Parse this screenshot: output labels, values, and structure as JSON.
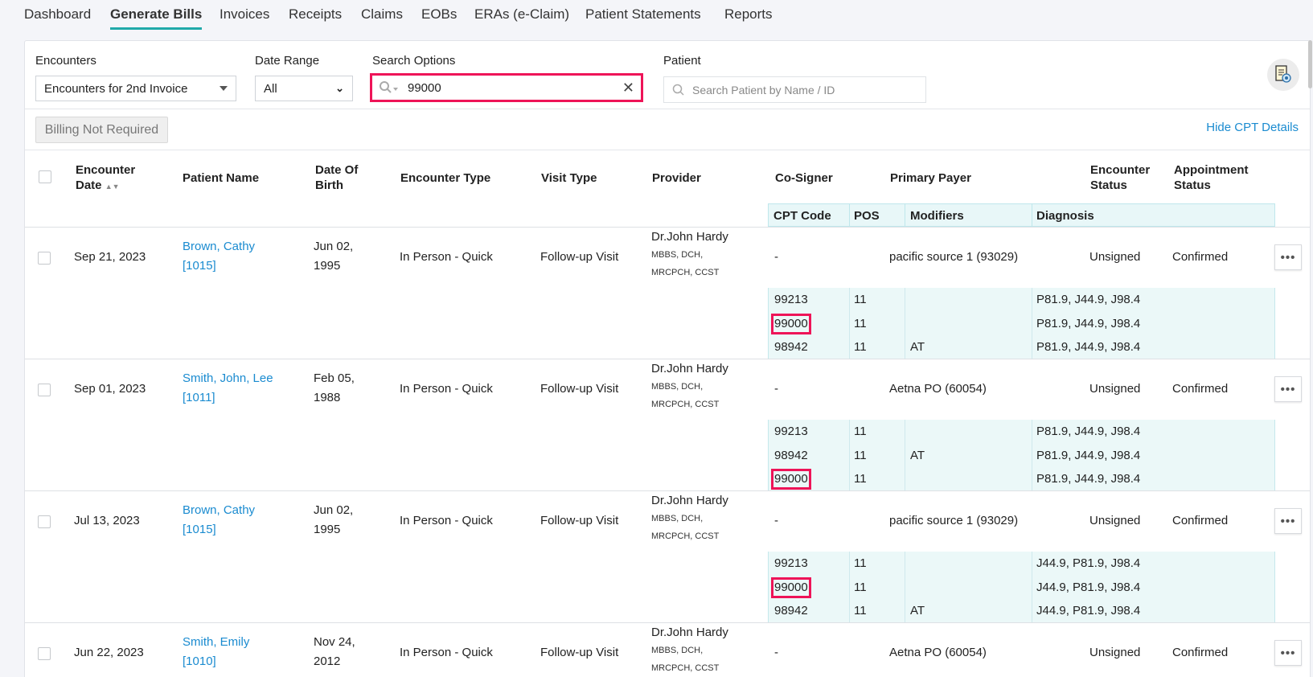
{
  "nav": {
    "items": [
      {
        "label": "Dashboard",
        "active": false
      },
      {
        "label": "Generate Bills",
        "active": true
      },
      {
        "label": "Invoices",
        "active": false
      },
      {
        "label": "Receipts",
        "active": false
      },
      {
        "label": "Claims",
        "active": false
      },
      {
        "label": "EOBs",
        "active": false
      },
      {
        "label": "ERAs (e-Claim)",
        "active": false
      },
      {
        "label": "Patient Statements",
        "active": false
      },
      {
        "label": "Reports",
        "active": false
      }
    ]
  },
  "filters": {
    "encounters_label": "Encounters",
    "encounters_value": "Encounters for 2nd Invoice",
    "date_range_label": "Date Range",
    "date_range_value": "All",
    "search_options_label": "Search Options",
    "search_value": "99000",
    "patient_label": "Patient",
    "patient_placeholder": "Search Patient by Name / ID",
    "view_icon": "document-eye-icon"
  },
  "actions": {
    "billing_not_required": "Billing Not Required",
    "hide_cpt": "Hide CPT Details"
  },
  "table": {
    "headers": {
      "encounter_date": "Encounter Date",
      "patient_name": "Patient Name",
      "dob": "Date Of Birth",
      "encounter_type": "Encounter Type",
      "visit_type": "Visit Type",
      "provider": "Provider",
      "cosigner": "Co-Signer",
      "primary_payer": "Primary Payer",
      "encounter_status": "Encounter Status",
      "appointment_status": "Appointment Status",
      "cpt_code": "CPT Code",
      "pos": "POS",
      "modifiers": "Modifiers",
      "diagnosis": "Diagnosis"
    },
    "rows": [
      {
        "date": "Sep 21, 2023",
        "patient": "Brown, Cathy",
        "patient_id": "[1015]",
        "dob_1": "Jun 02,",
        "dob_2": "1995",
        "encounter_type": "In Person - Quick",
        "visit_type": "Follow-up Visit",
        "provider": "Dr.John Hardy",
        "provider_cred_1": "MBBS, DCH,",
        "provider_cred_2": "MRCPCH, CCST",
        "cosigner": "-",
        "payer": "pacific source 1 (93029)",
        "encounter_status": "Unsigned",
        "appointment_status": "Confirmed",
        "cpt": [
          {
            "code": "99213",
            "pos": "11",
            "modifiers": "",
            "diagnosis": "P81.9, J44.9, J98.4",
            "match": false
          },
          {
            "code": "99000",
            "pos": "11",
            "modifiers": "",
            "diagnosis": "P81.9, J44.9, J98.4",
            "match": true
          },
          {
            "code": "98942",
            "pos": "11",
            "modifiers": "AT",
            "diagnosis": "P81.9, J44.9, J98.4",
            "match": false
          }
        ]
      },
      {
        "date": "Sep 01, 2023",
        "patient": "Smith, John, Lee",
        "patient_id": "[1011]",
        "dob_1": "Feb 05,",
        "dob_2": "1988",
        "encounter_type": "In Person - Quick",
        "visit_type": "Follow-up Visit",
        "provider": "Dr.John Hardy",
        "provider_cred_1": "MBBS, DCH,",
        "provider_cred_2": "MRCPCH, CCST",
        "cosigner": "-",
        "payer": "Aetna PO (60054)",
        "encounter_status": "Unsigned",
        "appointment_status": "Confirmed",
        "cpt": [
          {
            "code": "99213",
            "pos": "11",
            "modifiers": "",
            "diagnosis": "P81.9, J44.9, J98.4",
            "match": false
          },
          {
            "code": "98942",
            "pos": "11",
            "modifiers": "AT",
            "diagnosis": "P81.9, J44.9, J98.4",
            "match": false
          },
          {
            "code": "99000",
            "pos": "11",
            "modifiers": "",
            "diagnosis": "P81.9, J44.9, J98.4",
            "match": true
          }
        ]
      },
      {
        "date": "Jul 13, 2023",
        "patient": "Brown, Cathy",
        "patient_id": "[1015]",
        "dob_1": "Jun 02,",
        "dob_2": "1995",
        "encounter_type": "In Person - Quick",
        "visit_type": "Follow-up Visit",
        "provider": "Dr.John Hardy",
        "provider_cred_1": "MBBS, DCH,",
        "provider_cred_2": "MRCPCH, CCST",
        "cosigner": "-",
        "payer": "pacific source 1 (93029)",
        "encounter_status": "Unsigned",
        "appointment_status": "Confirmed",
        "cpt": [
          {
            "code": "99213",
            "pos": "11",
            "modifiers": "",
            "diagnosis": "J44.9, P81.9, J98.4",
            "match": false
          },
          {
            "code": "99000",
            "pos": "11",
            "modifiers": "",
            "diagnosis": "J44.9, P81.9, J98.4",
            "match": true
          },
          {
            "code": "98942",
            "pos": "11",
            "modifiers": "AT",
            "diagnosis": "J44.9, P81.9, J98.4",
            "match": false
          }
        ]
      },
      {
        "date": "Jun 22, 2023",
        "patient": "Smith, Emily",
        "patient_id": "[1010]",
        "dob_1": "Nov 24,",
        "dob_2": "2012",
        "encounter_type": "In Person - Quick",
        "visit_type": "Follow-up Visit",
        "provider": "Dr.John Hardy",
        "provider_cred_1": "MBBS, DCH,",
        "provider_cred_2": "MRCPCH, CCST",
        "cosigner": "-",
        "payer": "Aetna PO (60054)",
        "encounter_status": "Unsigned",
        "appointment_status": "Confirmed",
        "cpt": []
      }
    ]
  }
}
